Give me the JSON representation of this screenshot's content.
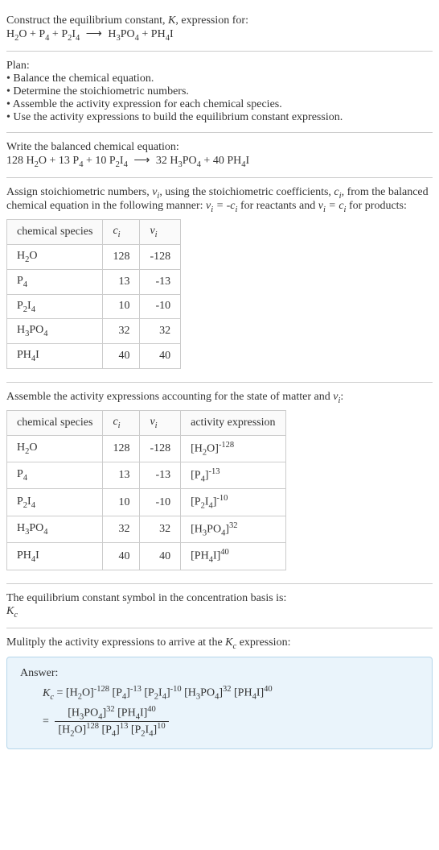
{
  "intro": {
    "line1_a": "Construct the equilibrium constant, ",
    "line1_b": ", expression for:"
  },
  "plan": {
    "heading": "Plan:",
    "b1": "• Balance the chemical equation.",
    "b2": "• Determine the stoichiometric numbers.",
    "b3": "• Assemble the activity expression for each chemical species.",
    "b4": "• Use the activity expressions to build the equilibrium constant expression."
  },
  "balanced": {
    "heading": "Write the balanced chemical equation:"
  },
  "assign": {
    "text_a": "Assign stoichiometric numbers, ",
    "text_b": ", using the stoichiometric coefficients, ",
    "text_c": ", from the balanced chemical equation in the following manner: ",
    "text_d": " for reactants and ",
    "text_e": " for products:"
  },
  "table1": {
    "h1": "chemical species",
    "rows": [
      {
        "sp": "H2O",
        "c": "128",
        "v": "-128"
      },
      {
        "sp": "P4",
        "c": "13",
        "v": "-13"
      },
      {
        "sp": "P2I4",
        "c": "10",
        "v": "-10"
      },
      {
        "sp": "H3PO4",
        "c": "32",
        "v": "32"
      },
      {
        "sp": "PH4I",
        "c": "40",
        "v": "40"
      }
    ]
  },
  "assemble": {
    "text_a": "Assemble the activity expressions accounting for the state of matter and ",
    "text_b": ":"
  },
  "table2": {
    "h1": "chemical species",
    "h4": "activity expression",
    "rows": [
      {
        "sp": "H2O",
        "c": "128",
        "v": "-128",
        "exp": "-128"
      },
      {
        "sp": "P4",
        "c": "13",
        "v": "-13",
        "exp": "-13"
      },
      {
        "sp": "P2I4",
        "c": "10",
        "v": "-10",
        "exp": "-10"
      },
      {
        "sp": "H3PO4",
        "c": "32",
        "v": "32",
        "exp": "32"
      },
      {
        "sp": "PH4I",
        "c": "40",
        "v": "40",
        "exp": "40"
      }
    ]
  },
  "symbol": {
    "text": "The equilibrium constant symbol in the concentration basis is:"
  },
  "multiply": {
    "text_a": "Mulitply the activity expressions to arrive at the ",
    "text_b": " expression:"
  },
  "answer": {
    "heading": "Answer:"
  },
  "coef": {
    "h2o": "128",
    "p4": "13",
    "p2i4": "10",
    "h3po4": "32",
    "ph4i": "40"
  },
  "chart_data": {
    "type": "table",
    "tables": [
      {
        "columns": [
          "chemical species",
          "c_i",
          "ν_i"
        ],
        "rows": [
          [
            "H2O",
            128,
            -128
          ],
          [
            "P4",
            13,
            -13
          ],
          [
            "P2I4",
            10,
            -10
          ],
          [
            "H3PO4",
            32,
            32
          ],
          [
            "PH4I",
            40,
            40
          ]
        ]
      },
      {
        "columns": [
          "chemical species",
          "c_i",
          "ν_i",
          "activity expression"
        ],
        "rows": [
          [
            "H2O",
            128,
            -128,
            "[H2O]^-128"
          ],
          [
            "P4",
            13,
            -13,
            "[P4]^-13"
          ],
          [
            "P2I4",
            10,
            -10,
            "[P2I4]^-10"
          ],
          [
            "H3PO4",
            32,
            32,
            "[H3PO4]^32"
          ],
          [
            "PH4I",
            40,
            40,
            "[PH4I]^40"
          ]
        ]
      }
    ]
  }
}
